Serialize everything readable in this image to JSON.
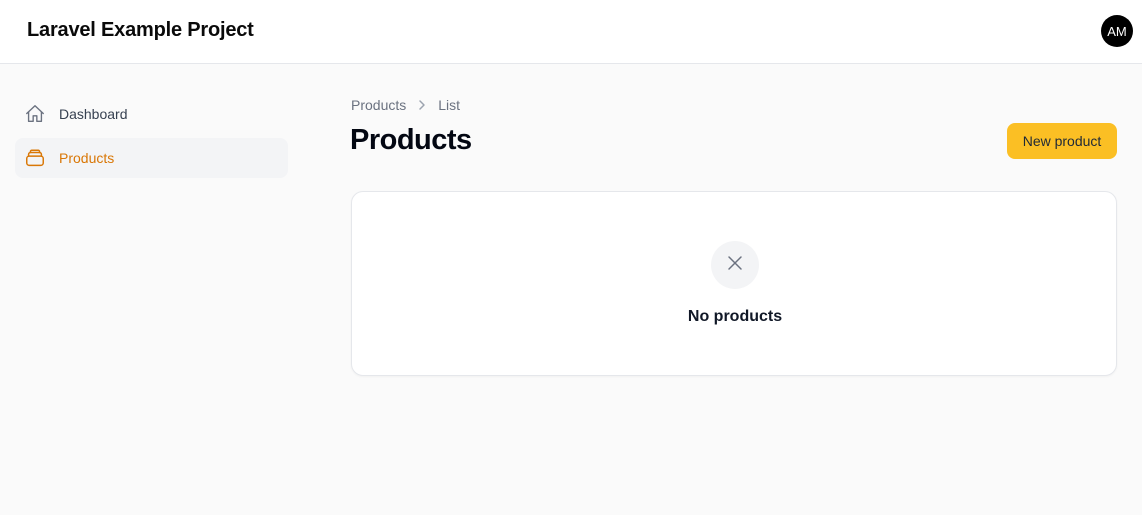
{
  "header": {
    "app_title": "Laravel Example Project",
    "avatar_initials": "AM"
  },
  "sidebar": {
    "items": [
      {
        "label": "Dashboard",
        "icon": "home-icon",
        "active": false
      },
      {
        "label": "Products",
        "icon": "stack-icon",
        "active": true
      }
    ]
  },
  "breadcrumb": {
    "items": [
      "Products",
      "List"
    ]
  },
  "main": {
    "title": "Products",
    "new_button_label": "New product",
    "empty_state": {
      "icon": "x-icon",
      "message": "No products"
    }
  },
  "colors": {
    "accent": "#fbbf24",
    "active_text": "#d97706",
    "background": "#fafafa"
  }
}
